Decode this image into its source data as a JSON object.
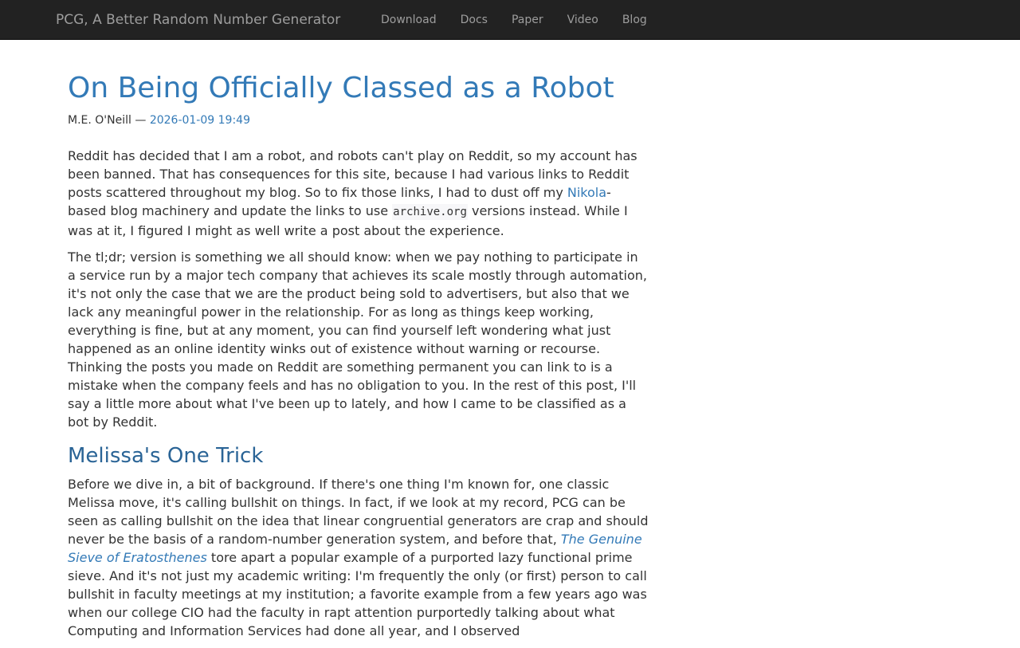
{
  "nav": {
    "brand": "PCG, A Better Random Number Generator",
    "links": [
      "Download",
      "Docs",
      "Paper",
      "Video",
      "Blog"
    ]
  },
  "post": {
    "title": "On Being Officially Classed as a Robot",
    "author": "M.E. O'Neill",
    "separator": " — ",
    "date": "2026-01-09 19:49",
    "p1": {
      "a": "Reddit has decided that I am a robot, and robots can't play on Reddit, so my account has been banned. That has consequences for this site, because I had various links to Reddit posts scattered throughout my blog. So to fix those links, I had to dust off my ",
      "link": "Nikola",
      "b": "-based blog machinery and update the links to use ",
      "code": "archive.org",
      "c": " versions instead. While I was at it, I figured I might as well write a post about the experience."
    },
    "p2": "The tl;dr; version is something we all should know: when we pay nothing to participate in a service run by a major tech company that achieves its scale mostly through automation, it's not only the case that we are the product being sold to advertisers, but also that we lack any meaningful power in the relationship. For as long as things keep working, everything is fine, but at any moment, you can find yourself left wondering what just happened as an online identity winks out of existence without warning or recourse. Thinking the posts you made on Reddit are something permanent you can link to is a mistake when the company feels and has no obligation to you. In the rest of this post, I'll say a little more about what I've been up to lately, and how I came to be classified as a bot by Reddit.",
    "section_heading": "Melissa's One Trick",
    "p3": {
      "a": "Before we dive in, a bit of background. If there's one thing I'm known for, one classic Melissa move, it's calling bullshit on things. In fact, if we look at my record, PCG can be seen as calling bullshit on the idea that linear congruential generators are crap and should never be the basis of a random-number generation system, and before that, ",
      "link": "The Genuine Sieve of Eratosthenes",
      "b": " tore apart a popular example of a purported lazy functional prime sieve. And it's not just my academic writing: I'm frequently the only (or first) person to call bullshit in faculty meetings at my institution; a favorite example from a few years ago was when our college CIO had the faculty in rapt attention purportedly talking about what Computing and Information Services had done all year, and I observed"
    }
  }
}
